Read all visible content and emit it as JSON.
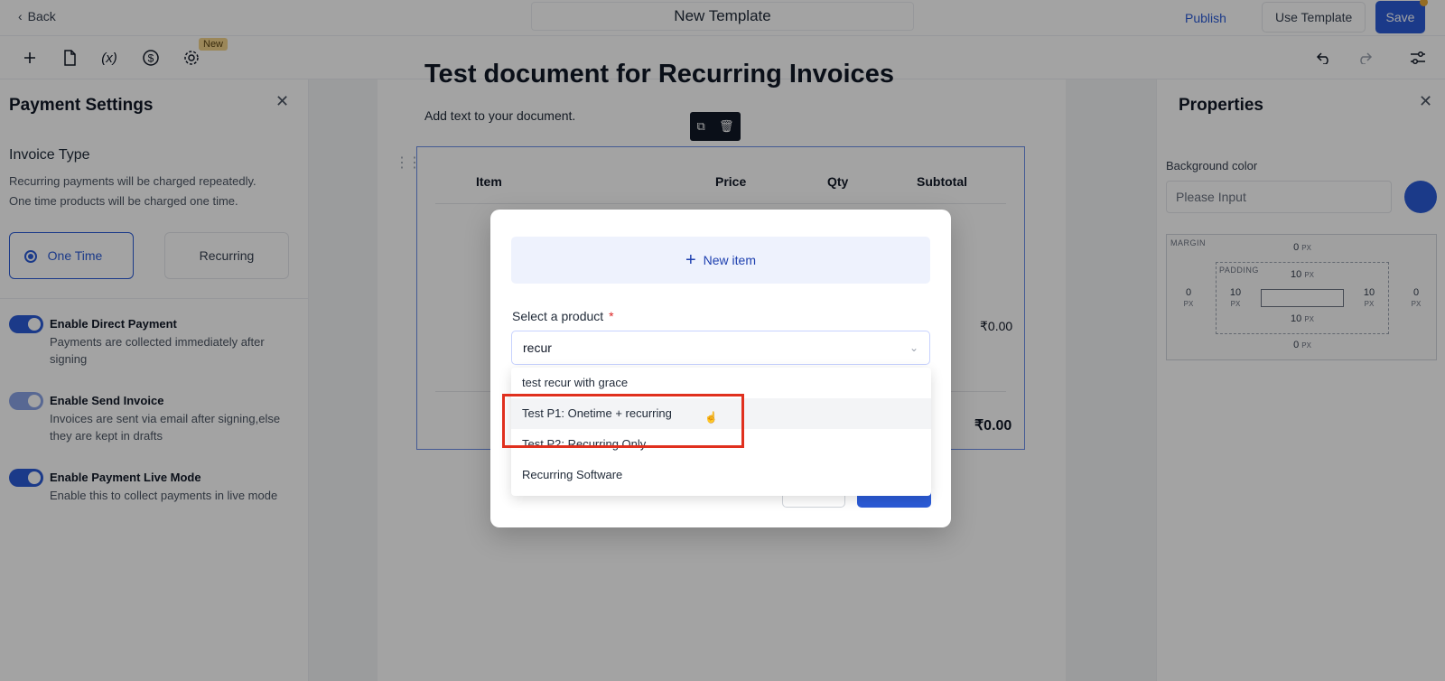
{
  "header": {
    "back_label": "Back",
    "title": "New Template",
    "publish_label": "Publish",
    "use_template_label": "Use Template",
    "save_label": "Save"
  },
  "toolbar": {
    "icons": [
      "plus-icon",
      "page-icon",
      "variable-icon",
      "dollar-icon",
      "gear-icon",
      "undo-icon",
      "redo-icon",
      "sliders-icon"
    ],
    "variable_glyph": "(x)",
    "new_badge": "New"
  },
  "left_panel": {
    "title": "Payment Settings",
    "invoice_type_title": "Invoice Type",
    "help_line1": "Recurring payments will be charged repeatedly.",
    "help_line2": "One time products will be charged one time.",
    "options": [
      {
        "label": "One Time",
        "selected": true
      },
      {
        "label": "Recurring",
        "selected": false
      }
    ],
    "toggles": [
      {
        "title": "Enable Direct Payment",
        "desc": "Payments are collected immediately after signing",
        "on": true
      },
      {
        "title": "Enable Send Invoice",
        "desc": "Invoices are sent via email after signing,else they are kept in drafts",
        "on": true
      },
      {
        "title": "Enable Payment Live Mode",
        "desc": "Enable this to collect payments in live mode",
        "on": true
      }
    ]
  },
  "document": {
    "heading": "Test document for Recurring Invoices",
    "text": "Add text to your document.",
    "table": {
      "headers": [
        "Item",
        "Price",
        "Qty",
        "Subtotal"
      ],
      "row_amount": "₹0.00",
      "total_amount": "₹0.00"
    }
  },
  "right_panel": {
    "title": "Properties",
    "bg_label": "Background color",
    "bg_placeholder": "Please Input",
    "swatch_color": "#2b5bd7",
    "margin_label": "MARGIN",
    "padding_label": "PADDING",
    "margin": {
      "top": "0",
      "right": "0",
      "bottom": "0",
      "left": "0"
    },
    "padding": {
      "top": "10",
      "right": "10",
      "bottom": "10",
      "left": "10"
    },
    "unit": "PX"
  },
  "modal": {
    "new_item_label": "New item",
    "select_label": "Select a product",
    "required_mark": "*",
    "search_value": "recur",
    "options": [
      "test recur with grace",
      "Test P1: Onetime + recurring",
      "Test P2: Recurring Only",
      "Recurring Software"
    ],
    "hovered_index": 1
  },
  "colors": {
    "accent": "#2b5bd7",
    "highlight": "#e0301e",
    "badge": "#f3d48b"
  }
}
